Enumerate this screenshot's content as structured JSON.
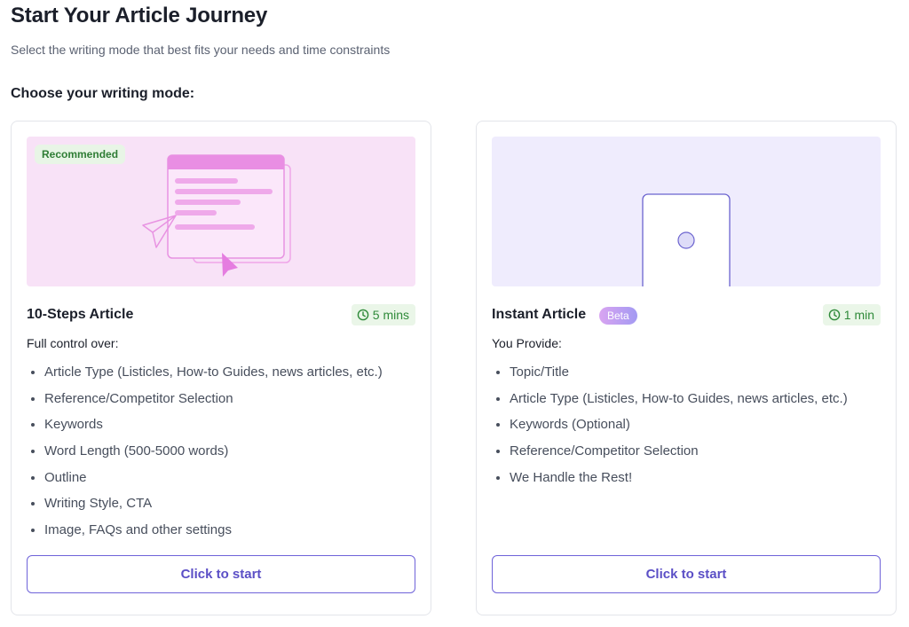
{
  "header": {
    "title": "Start Your Article Journey",
    "subtitle": "Select the writing mode that best fits your needs and time constraints",
    "section_label": "Choose your writing mode:"
  },
  "cards": [
    {
      "badge": "Recommended",
      "title": "10-Steps Article",
      "time": "5 mins",
      "lead": "Full control over:",
      "features": [
        "Article Type (Listicles, How-to Guides, news articles, etc.)",
        "Reference/Competitor Selection",
        "Keywords",
        "Word Length (500-5000 words)",
        "Outline",
        "Writing Style, CTA",
        "Image, FAQs and other settings"
      ],
      "button": "Click to start",
      "hero_color": "#f8e2f7",
      "icon": "document-with-cursor-illustration"
    },
    {
      "badge": "Beta",
      "title": "Instant Article",
      "time": "1 min",
      "lead": "You Provide:",
      "features": [
        "Topic/Title",
        "Article Type (Listicles, How-to Guides, news articles, etc.)",
        "Keywords (Optional)",
        "Reference/Competitor Selection",
        "We Handle the Rest!"
      ],
      "button": "Click to start",
      "hero_color": "#efecfd",
      "icon": "phone-illustration"
    }
  ],
  "colors": {
    "accent": "#5b4fc6",
    "button_border": "#6f63d9",
    "time_chip_bg": "#eaf6e8",
    "time_chip_text": "#2f8a3a",
    "recommended_bg": "#e8f5e6",
    "recommended_text": "#2f7d35"
  }
}
